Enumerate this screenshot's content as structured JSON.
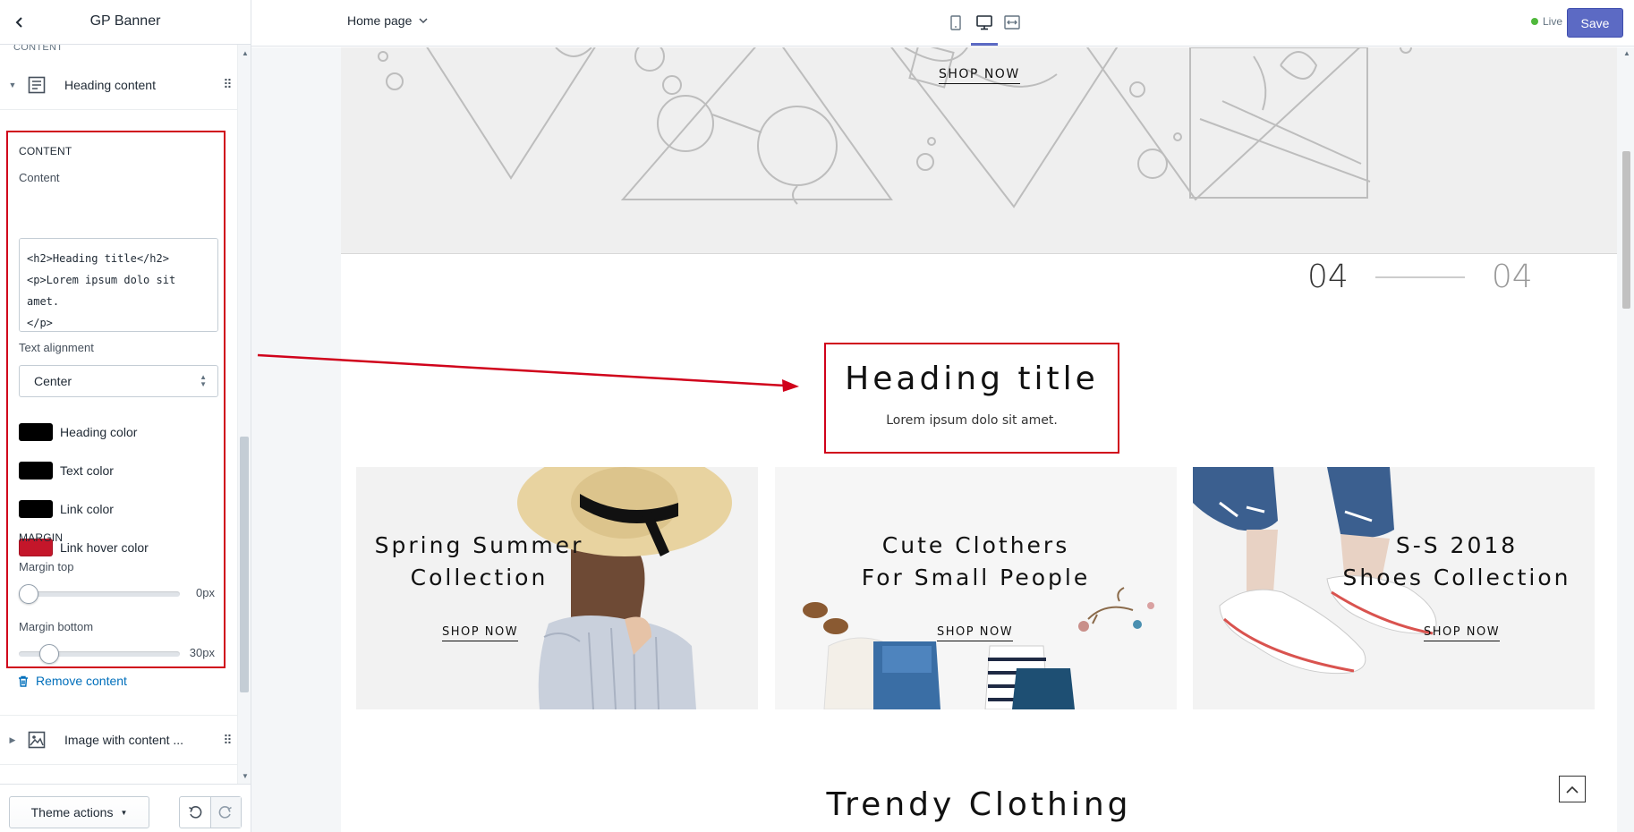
{
  "sidebar": {
    "title": "GP Banner",
    "top_section_label": "CONTENT",
    "heading_block_label": "Heading content",
    "settings": {
      "content_section": "CONTENT",
      "content_label": "Content",
      "content_value": "<h2>Heading title</h2>\n<p>Lorem ipsum dolo sit amet.\n</p>",
      "text_alignment_label": "Text alignment",
      "text_alignment_value": "Center",
      "colors": [
        {
          "label": "Heading color",
          "value": "#000000"
        },
        {
          "label": "Text color",
          "value": "#000000"
        },
        {
          "label": "Link color",
          "value": "#000000"
        },
        {
          "label": "Link hover color",
          "value": "#c4162a"
        }
      ],
      "margin_section": "MARGIN",
      "margin_top_label": "Margin top",
      "margin_top_value": "0px",
      "margin_bottom_label": "Margin bottom",
      "margin_bottom_value": "30px"
    },
    "remove_content": "Remove content",
    "image_block_label": "Image with content ...",
    "theme_actions": "Theme actions"
  },
  "topbar": {
    "page": "Home page",
    "live": "Live",
    "save": "Save"
  },
  "preview": {
    "hero_shop_now": "SHOP NOW",
    "slide_current": "04",
    "slide_total": "04",
    "heading_title": "Heading title",
    "heading_text": "Lorem ipsum dolo sit amet.",
    "banners": [
      {
        "line1": "Spring Summer",
        "line2": "Collection",
        "shop": "SHOP NOW"
      },
      {
        "line1": "Cute Clothers",
        "line2": "For Small People",
        "shop": "SHOP NOW"
      },
      {
        "line1": "S-S 2018",
        "line2": "Shoes Collection",
        "shop": "SHOP NOW"
      }
    ],
    "section_title": "Trendy Clothing"
  },
  "colors": {
    "accent": "#5c6ac4",
    "annotation": "#d0021b",
    "link": "#006fbb"
  }
}
